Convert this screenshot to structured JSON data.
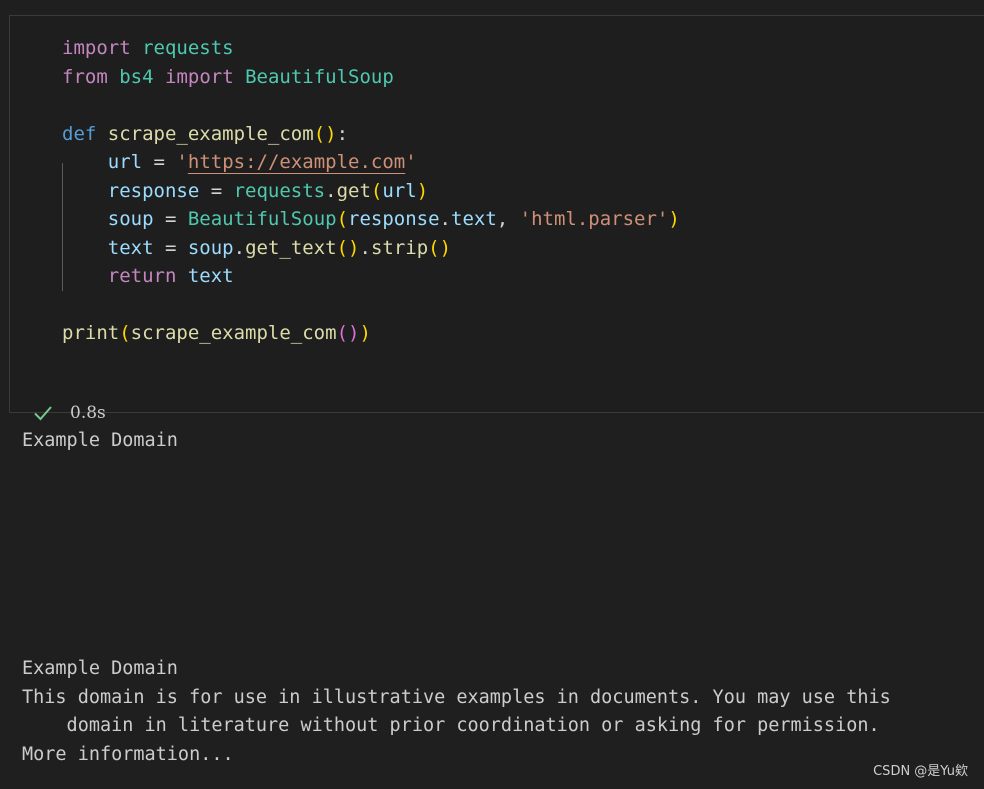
{
  "cell": {
    "code_lines": [
      [
        {
          "t": "import",
          "c": "kw-purple"
        },
        {
          "t": " ",
          "c": "op"
        },
        {
          "t": "requests",
          "c": "mod"
        }
      ],
      [
        {
          "t": "from",
          "c": "kw-purple"
        },
        {
          "t": " ",
          "c": "op"
        },
        {
          "t": "bs4",
          "c": "mod"
        },
        {
          "t": " ",
          "c": "op"
        },
        {
          "t": "import",
          "c": "kw-purple"
        },
        {
          "t": " ",
          "c": "op"
        },
        {
          "t": "BeautifulSoup",
          "c": "mod"
        }
      ],
      [],
      [
        {
          "t": "def",
          "c": "kw-blue"
        },
        {
          "t": " ",
          "c": "op"
        },
        {
          "t": "scrape_example_com",
          "c": "fn"
        },
        {
          "t": "()",
          "c": "paren1"
        },
        {
          "t": ":",
          "c": "op"
        }
      ],
      [
        {
          "t": "    ",
          "c": "op"
        },
        {
          "t": "url",
          "c": "var"
        },
        {
          "t": " = ",
          "c": "op"
        },
        {
          "t": "'",
          "c": "str"
        },
        {
          "t": "https://example.com",
          "c": "str url-u"
        },
        {
          "t": "'",
          "c": "str"
        }
      ],
      [
        {
          "t": "    ",
          "c": "op"
        },
        {
          "t": "response",
          "c": "var"
        },
        {
          "t": " = ",
          "c": "op"
        },
        {
          "t": "requests",
          "c": "mod"
        },
        {
          "t": ".",
          "c": "op"
        },
        {
          "t": "get",
          "c": "fn"
        },
        {
          "t": "(",
          "c": "paren1"
        },
        {
          "t": "url",
          "c": "var"
        },
        {
          "t": ")",
          "c": "paren1"
        }
      ],
      [
        {
          "t": "    ",
          "c": "op"
        },
        {
          "t": "soup",
          "c": "var"
        },
        {
          "t": " = ",
          "c": "op"
        },
        {
          "t": "BeautifulSoup",
          "c": "mod"
        },
        {
          "t": "(",
          "c": "paren1"
        },
        {
          "t": "response",
          "c": "var"
        },
        {
          "t": ".",
          "c": "op"
        },
        {
          "t": "text",
          "c": "var"
        },
        {
          "t": ", ",
          "c": "op"
        },
        {
          "t": "'html.parser'",
          "c": "str"
        },
        {
          "t": ")",
          "c": "paren1"
        }
      ],
      [
        {
          "t": "    ",
          "c": "op"
        },
        {
          "t": "text",
          "c": "var"
        },
        {
          "t": " = ",
          "c": "op"
        },
        {
          "t": "soup",
          "c": "var"
        },
        {
          "t": ".",
          "c": "op"
        },
        {
          "t": "get_text",
          "c": "fn"
        },
        {
          "t": "()",
          "c": "paren1"
        },
        {
          "t": ".",
          "c": "op"
        },
        {
          "t": "strip",
          "c": "fn"
        },
        {
          "t": "()",
          "c": "paren1"
        }
      ],
      [
        {
          "t": "    ",
          "c": "op"
        },
        {
          "t": "return",
          "c": "kw-purple"
        },
        {
          "t": " ",
          "c": "op"
        },
        {
          "t": "text",
          "c": "var"
        }
      ],
      [],
      [
        {
          "t": "print",
          "c": "fn"
        },
        {
          "t": "(",
          "c": "paren1"
        },
        {
          "t": "scrape_example_com",
          "c": "fn"
        },
        {
          "t": "()",
          "c": "paren2"
        },
        {
          "t": ")",
          "c": "paren1"
        }
      ]
    ],
    "status": {
      "icon": "check-icon",
      "duration": "0.8s",
      "color": "#73c991"
    }
  },
  "output": {
    "block1": "Example Domain",
    "block2": "Example Domain\nThis domain is for use in illustrative examples in documents. You may use this\n    domain in literature without prior coordination or asking for permission.\nMore information..."
  },
  "watermark": "CSDN @是Yu欸"
}
